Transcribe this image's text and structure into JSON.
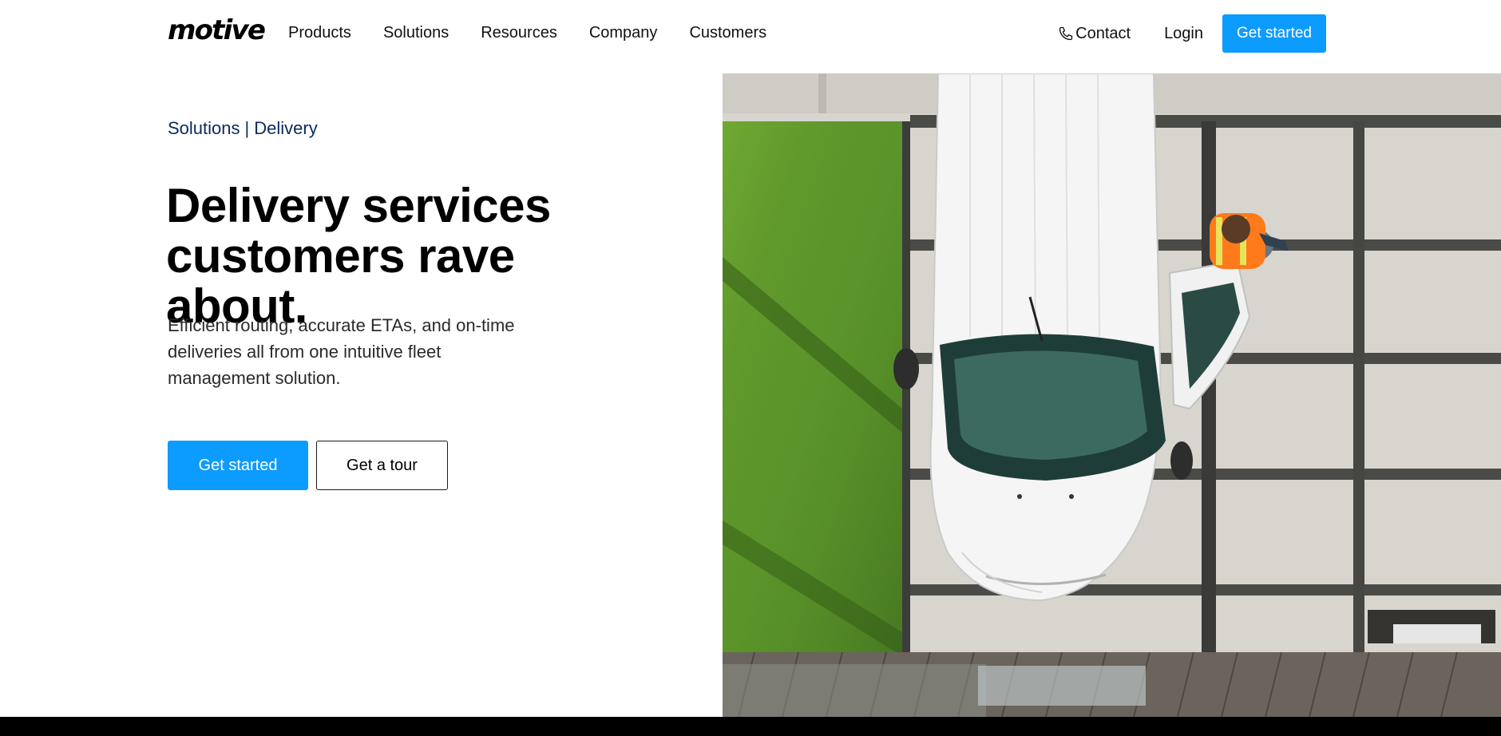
{
  "header": {
    "logo": "motive",
    "nav": [
      "Products",
      "Solutions",
      "Resources",
      "Company",
      "Customers"
    ],
    "contact_label": "Contact",
    "login_label": "Login",
    "cta_label": "Get started"
  },
  "hero": {
    "breadcrumb": {
      "parent": "Solutions",
      "separator": "|",
      "current": "Delivery"
    },
    "headline": "Delivery services customers rave about.",
    "subtext": "Efficient routing, accurate ETAs, and on-time deliveries all from one intuitive fleet management solution.",
    "primary_cta": "Get started",
    "secondary_cta": "Get a tour"
  },
  "colors": {
    "accent": "#0c9bff",
    "breadcrumb": "#0b2a5c",
    "text": "#000000"
  },
  "icons": {
    "contact": "phone-icon"
  }
}
